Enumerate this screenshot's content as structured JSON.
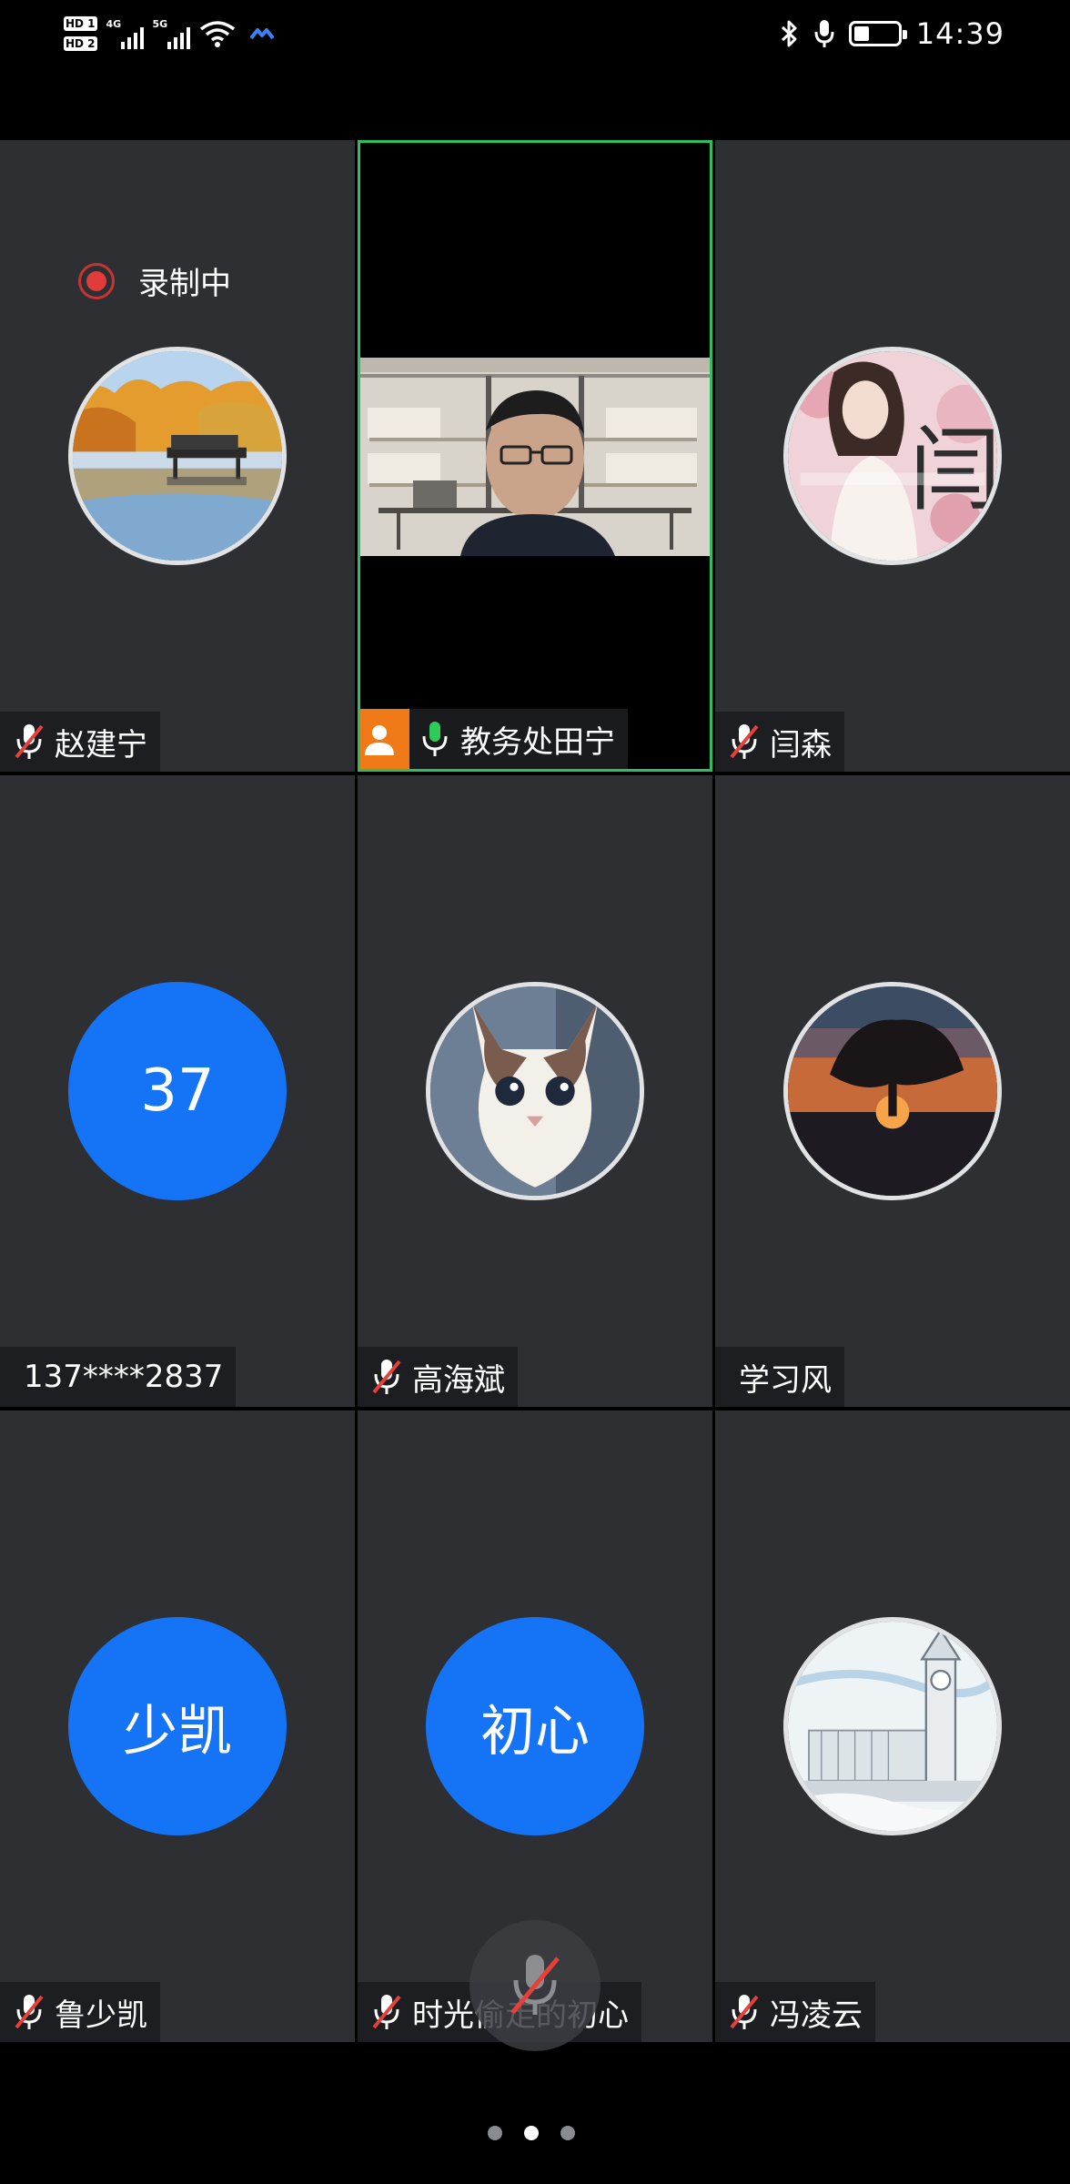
{
  "status_bar": {
    "sim1": "HD 1",
    "sim2": "HD 2",
    "net1": "4G",
    "net2": "5G",
    "time": "14:39",
    "battery_level": 0.35
  },
  "recording": {
    "label": "录制中"
  },
  "participants": [
    {
      "name": "赵建宁",
      "avatar": "lake-photo-avatar",
      "mic": "muted"
    },
    {
      "name": "教务处田宁",
      "avatar": "camera-video",
      "mic": "on",
      "host": true,
      "active_speaker": true
    },
    {
      "name": "闫森",
      "avatar": "girl-photo-avatar",
      "mic": "muted"
    },
    {
      "name": "137****2837",
      "avatar_text": "37",
      "mic": "none"
    },
    {
      "name": "高海斌",
      "avatar": "cat-photo-avatar",
      "mic": "muted"
    },
    {
      "name": "学习风",
      "avatar": "sunset-tree-avatar",
      "mic": "none"
    },
    {
      "name": "鲁少凯",
      "avatar_text": "少凯",
      "mic": "muted"
    },
    {
      "name": "时光偷走的初心",
      "avatar_text": "初心",
      "mic": "muted"
    },
    {
      "name": "冯凌云",
      "avatar": "big-ben-sketch-avatar",
      "mic": "muted"
    }
  ],
  "floating_control": {
    "icon": "mic-muted-icon"
  },
  "pager": {
    "pages": 3,
    "current": 2
  },
  "colors": {
    "tile_bg": "#2e2f33",
    "active_border": "#2fbf63",
    "text_avatar_bg": "#1474f5",
    "host_badge": "#f07a18",
    "muted_slash": "#e5413a"
  }
}
